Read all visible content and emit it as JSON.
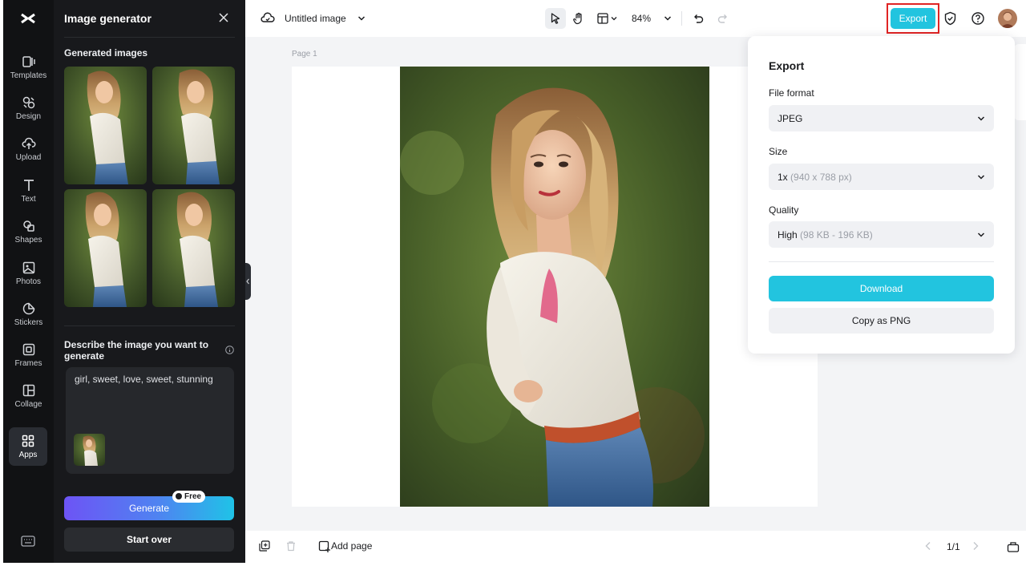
{
  "rail": {
    "logo_icon": "capcut-logo-icon",
    "items": [
      {
        "label": "Templates",
        "icon": "templates-icon"
      },
      {
        "label": "Design",
        "icon": "design-icon"
      },
      {
        "label": "Upload",
        "icon": "upload-icon"
      },
      {
        "label": "Text",
        "icon": "text-icon"
      },
      {
        "label": "Shapes",
        "icon": "shapes-icon"
      },
      {
        "label": "Photos",
        "icon": "photos-icon"
      },
      {
        "label": "Stickers",
        "icon": "stickers-icon"
      },
      {
        "label": "Frames",
        "icon": "frames-icon"
      },
      {
        "label": "Collage",
        "icon": "collage-icon"
      },
      {
        "label": "Apps",
        "icon": "apps-icon",
        "active": true
      }
    ],
    "keyboard_icon": "keyboard-icon"
  },
  "panel": {
    "title": "Image generator",
    "generated_label": "Generated images",
    "describe_label": "Describe the image you want to generate",
    "prompt_text": "girl, sweet, love, sweet, stunning",
    "generate_label": "Generate",
    "free_badge": "Free",
    "start_over_label": "Start over"
  },
  "topbar": {
    "doc_title": "Untitled image",
    "zoom": "84%",
    "export_label": "Export",
    "accent_color": "#22c4df",
    "highlight_color": "#e02424"
  },
  "canvas": {
    "page_label": "Page 1"
  },
  "bottombar": {
    "add_page_label": "Add page",
    "page_count": "1/1"
  },
  "export_popover": {
    "title": "Export",
    "file_format_label": "File format",
    "file_format_value": "JPEG",
    "size_label": "Size",
    "size_value": "1x",
    "size_detail": "(940 x 788 px)",
    "quality_label": "Quality",
    "quality_value": "High",
    "quality_detail": "(98 KB - 196 KB)",
    "download_label": "Download",
    "copy_label": "Copy as PNG"
  }
}
